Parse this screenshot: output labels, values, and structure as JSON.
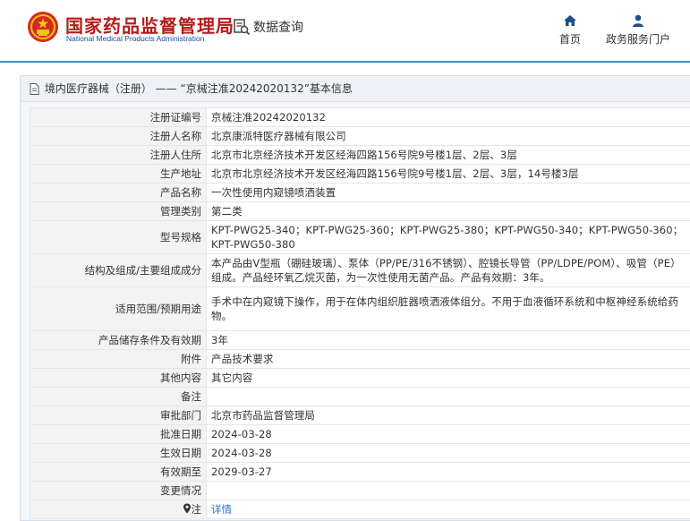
{
  "header": {
    "logo_cn": "国家药品监督管理局",
    "logo_en": "National Medical Products Administration",
    "query_label": "数据查询",
    "nav": [
      {
        "label": "首页",
        "icon": "home-icon"
      },
      {
        "label": "政务服务门户",
        "icon": "user-icon"
      }
    ]
  },
  "breadcrumb": {
    "category": "境内医疗器械（注册）",
    "separator": "——",
    "current": "“京械注准20242020132”基本信息"
  },
  "colors": {
    "accent": "#3a8ede",
    "brand_red": "#b51c1c",
    "link": "#2a6fd1"
  },
  "rows": [
    {
      "label": "注册证编号",
      "value": "京械注准20242020132"
    },
    {
      "label": "注册人名称",
      "value": "北京康派特医疗器械有限公司"
    },
    {
      "label": "注册人住所",
      "value": "北京市北京经济技术开发区经海四路156号院9号楼1层、2层、3层"
    },
    {
      "label": "生产地址",
      "value": "北京市北京经济技术开发区经海四路156号院9号楼1层、2层、3层，14号楼3层"
    },
    {
      "label": "产品名称",
      "value": "一次性使用内窥镜喷洒装置"
    },
    {
      "label": "管理类别",
      "value": "第二类"
    },
    {
      "label": "型号规格",
      "value": "KPT-PWG25-340；KPT-PWG25-360；KPT-PWG25-380；KPT-PWG50-340；KPT-PWG50-360；KPT-PWG50-380"
    },
    {
      "label": "结构及组成/主要组成成分",
      "value": "本产品由V型瓶（硼硅玻璃）、泵体（PP/PE/316不锈钢）、腔镜长导管（PP/LDPE/POM）、吸管（PE）组成。产品经环氧乙烷灭菌，为一次性使用无菌产品。产品有效期：3年。"
    },
    {
      "label": "适用范围/预期用途",
      "value": "手术中在内窥镜下操作，用于在体内组织脏器喷洒液体组分。不用于血液循环系统和中枢神经系统给药物。"
    },
    {
      "label": "产品储存条件及有效期",
      "value": "3年"
    },
    {
      "label": "附件",
      "value": "产品技术要求"
    },
    {
      "label": "其他内容",
      "value": "其它内容"
    },
    {
      "label": "备注",
      "value": ""
    },
    {
      "label": "审批部门",
      "value": "北京市药品监督管理局"
    },
    {
      "label": "批准日期",
      "value": "2024-03-28"
    },
    {
      "label": "生效日期",
      "value": "2024-03-28"
    },
    {
      "label": "有效期至",
      "value": "2029-03-27"
    },
    {
      "label": "变更情况",
      "value": ""
    }
  ],
  "note": {
    "label": "注",
    "link": "详情",
    "icon": "location-pin-icon"
  }
}
